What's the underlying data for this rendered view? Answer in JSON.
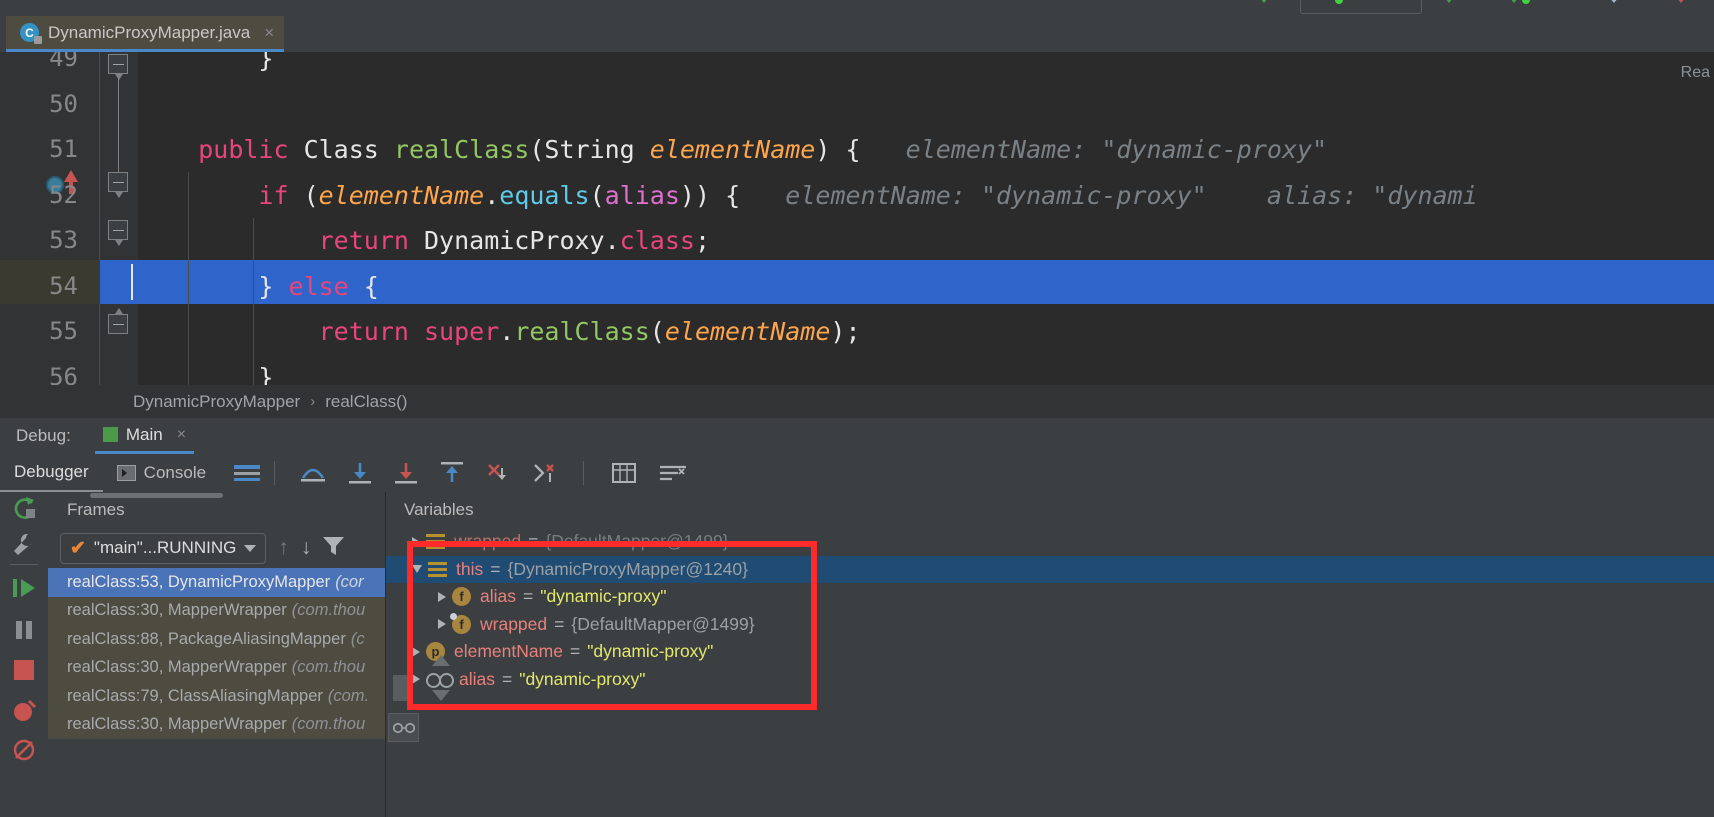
{
  "window": {
    "tab": {
      "filename": "DynamicProxyMapper.java",
      "class_icon": "C",
      "close": "×"
    },
    "top_breadcrumb": "",
    "editor_right_label": "Rea"
  },
  "editor": {
    "lines": [
      {
        "num": "49",
        "indent": 4,
        "tokens": [
          {
            "t": "}",
            "c": "k-white"
          }
        ],
        "hint": ""
      },
      {
        "num": "50",
        "indent": 0,
        "tokens": [],
        "hint": ""
      },
      {
        "num": "51",
        "indent": 2,
        "tokens": [
          {
            "t": "public ",
            "c": "k-kw"
          },
          {
            "t": "Class ",
            "c": "k-white"
          },
          {
            "t": "realClass",
            "c": "k-lime"
          },
          {
            "t": "(",
            "c": "k-white"
          },
          {
            "t": "String ",
            "c": "k-white"
          },
          {
            "t": "elementName",
            "c": "k-orange i"
          },
          {
            "t": ") {",
            "c": "k-white"
          }
        ],
        "hint": "elementName: \"dynamic-proxy\""
      },
      {
        "num": "52",
        "indent": 4,
        "tokens": [
          {
            "t": "if ",
            "c": "k-kw"
          },
          {
            "t": "(",
            "c": "k-white"
          },
          {
            "t": "elementName",
            "c": "k-orange i"
          },
          {
            "t": ".",
            "c": "k-white"
          },
          {
            "t": "equals",
            "c": "k-cyan"
          },
          {
            "t": "(",
            "c": "k-white"
          },
          {
            "t": "alias",
            "c": "k-magenta"
          },
          {
            "t": ")) {",
            "c": "k-white"
          }
        ],
        "hint": "elementName: \"dynamic-proxy\"    alias: \"dynami"
      },
      {
        "num": "53",
        "indent": 6,
        "tokens": [
          {
            "t": "return ",
            "c": "k-kw"
          },
          {
            "t": "DynamicProxy",
            "c": "k-white"
          },
          {
            "t": ".",
            "c": "k-white"
          },
          {
            "t": "class",
            "c": "k-kw"
          },
          {
            "t": ";",
            "c": "k-white"
          }
        ],
        "hint": "",
        "highlighted": true
      },
      {
        "num": "54",
        "indent": 4,
        "tokens": [
          {
            "t": "} ",
            "c": "k-white"
          },
          {
            "t": "else",
            "c": "k-kw"
          },
          {
            "t": " {",
            "c": "k-white"
          }
        ],
        "hint": ""
      },
      {
        "num": "55",
        "indent": 6,
        "tokens": [
          {
            "t": "return ",
            "c": "k-kw"
          },
          {
            "t": "super",
            "c": "k-kw"
          },
          {
            "t": ".",
            "c": "k-white"
          },
          {
            "t": "realClass",
            "c": "k-lime"
          },
          {
            "t": "(",
            "c": "k-white"
          },
          {
            "t": "elementName",
            "c": "k-orange i"
          },
          {
            "t": ");",
            "c": "k-white"
          }
        ],
        "hint": ""
      },
      {
        "num": "56",
        "indent": 4,
        "tokens": [
          {
            "t": "}",
            "c": "k-white"
          }
        ],
        "hint": ""
      }
    ]
  },
  "breadcrumb": {
    "class": "DynamicProxyMapper",
    "separator": "›",
    "method": "realClass()"
  },
  "debug_header": {
    "label": "Debug:",
    "session": "Main",
    "close": "×"
  },
  "debug_toolbar": {
    "tabs": [
      {
        "label": "Debugger",
        "active": true
      },
      {
        "label": "Console",
        "active": false
      }
    ],
    "icons": [
      "layout-icon",
      "separator",
      "step-over-icon",
      "step-into-icon",
      "force-step-into-icon",
      "step-out-icon",
      "drop-frame-icon",
      "run-to-cursor-icon",
      "separator2",
      "evaluate-icon",
      "mute-breakpoints-icon"
    ]
  },
  "left_rail": {
    "buttons": [
      "rerun-icon",
      "settings-icon",
      "resume-icon",
      "pause-icon",
      "stop-icon",
      "view-breakpoints-icon",
      "mute-breakpoints-icon"
    ]
  },
  "frames": {
    "title": "Frames",
    "thread": {
      "label": "\"main\"...RUNNING",
      "state_icon": "check-icon"
    },
    "toolbar": [
      "up-arrow-icon",
      "down-arrow-icon",
      "filter-icon"
    ],
    "items": [
      {
        "method": "realClass:53, DynamicProxyMapper",
        "pkg": "(cor",
        "selected": true
      },
      {
        "method": "realClass:30, MapperWrapper",
        "pkg": "(com.thou",
        "selected": false
      },
      {
        "method": "realClass:88, PackageAliasingMapper",
        "pkg": "(c",
        "selected": false
      },
      {
        "method": "realClass:30, MapperWrapper",
        "pkg": "(com.thou",
        "selected": false
      },
      {
        "method": "realClass:79, ClassAliasingMapper",
        "pkg": "(com.",
        "selected": false
      },
      {
        "method": "realClass:30, MapperWrapper",
        "pkg": "(com.thou",
        "selected": false
      }
    ]
  },
  "variables": {
    "title": "Variables",
    "rows": [
      {
        "expand": "right",
        "icon": "object-icon",
        "name": "wrapped",
        "eq": "=",
        "value": "{DefaultMapper@1499}",
        "value_kind": "ref",
        "indent": 1,
        "selected": false,
        "dim": true
      },
      {
        "expand": "down",
        "icon": "object-icon",
        "name": "this",
        "eq": "=",
        "value": "{DynamicProxyMapper@1240}",
        "value_kind": "ref",
        "indent": 1,
        "selected": true,
        "dim": false
      },
      {
        "expand": "right",
        "icon": "field-icon",
        "name": "alias",
        "eq": "=",
        "value": "\"dynamic-proxy\"",
        "value_kind": "str",
        "indent": 2,
        "selected": false,
        "dim": false
      },
      {
        "expand": "right",
        "icon": "field-icon-modified",
        "name": "wrapped",
        "eq": "=",
        "value": "{DefaultMapper@1499}",
        "value_kind": "ref",
        "indent": 2,
        "selected": false,
        "dim": false
      },
      {
        "expand": "right",
        "icon": "parameter-icon",
        "name": "elementName",
        "eq": "=",
        "value": "\"dynamic-proxy\"",
        "value_kind": "str",
        "indent": 1,
        "selected": false,
        "dim": false
      },
      {
        "expand": "right",
        "icon": "watch-icon",
        "name": "alias",
        "eq": "=",
        "value": "\"dynamic-proxy\"",
        "value_kind": "str",
        "indent": 1,
        "selected": false,
        "dim": false
      }
    ]
  },
  "annotation": {
    "highlight_color": "#ff2b2b",
    "shape": "rectangle"
  },
  "colors": {
    "editor_bg": "#2b2b2b",
    "panel_bg": "#3c3f41",
    "selection_blue": "#2f65ca",
    "frames_bg": "#4e4b41",
    "tab_underline": "#4a88c7",
    "string_yellow": "#e3e86b",
    "var_name_red": "#e8807b"
  }
}
